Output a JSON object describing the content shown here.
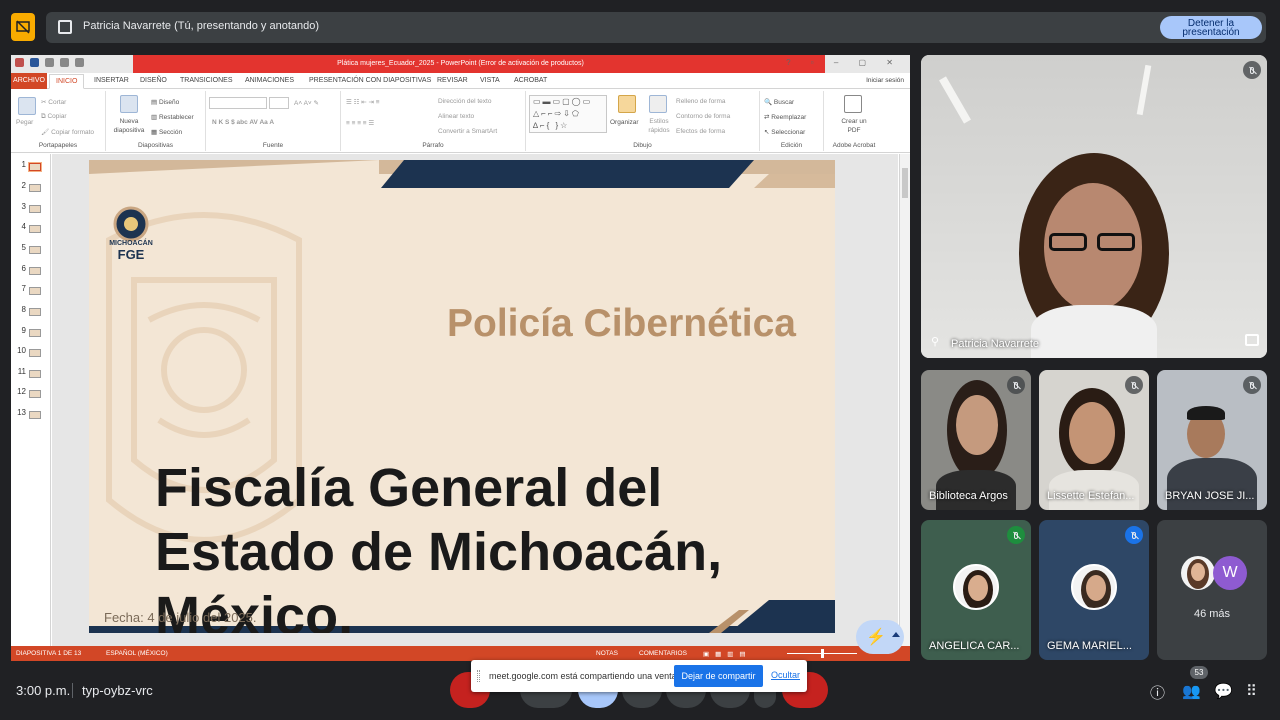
{
  "meet": {
    "presenter_banner": "Patricia Navarrete (Tú, presentando y anotando)",
    "stop_button": "Detener la presentación",
    "time": "3:00 p.m.",
    "meeting_code": "typ-oybz-vrc",
    "people_count": "53",
    "share_notice": {
      "message": "meet.google.com está compartiendo una ventana.",
      "stop_share": "Dejar de compartir",
      "hide": "Ocultar"
    }
  },
  "powerpoint": {
    "window_title": "Plática mujeres_Ecuador_2025 -  PowerPoint (Error de activación de productos)",
    "tabs": [
      "ARCHIVO",
      "INICIO",
      "INSERTAR",
      "DISEÑO",
      "TRANSICIONES",
      "ANIMACIONES",
      "PRESENTACIÓN CON DIAPOSITIVAS",
      "REVISAR",
      "VISTA",
      "ACROBAT"
    ],
    "sign_in": "Iniciar sesión",
    "groups": {
      "clipboard": {
        "label": "Portapapeles",
        "paste": "Pegar",
        "cut": "Cortar",
        "copy": "Copiar",
        "format_painter": "Copiar formato"
      },
      "slides": {
        "label": "Diapositivas",
        "new_slide": "Nueva diapositiva",
        "layout": "Diseño",
        "reset": "Restablecer",
        "section": "Sección"
      },
      "font": {
        "label": "Fuente",
        "buttons": "N  K  S  $  abc  AV  Aa  A"
      },
      "paragraph": {
        "label": "Párrafo",
        "text_direction": "Dirección del texto",
        "align_text": "Alinear texto",
        "smartart": "Convertir a SmartArt"
      },
      "drawing": {
        "label": "Dibujo",
        "arrange": "Organizar",
        "quick_styles": "Estilos rápidos",
        "fill": "Relleno de forma",
        "outline": "Contorno de forma",
        "effects": "Efectos de forma"
      },
      "editing": {
        "label": "Edición",
        "find": "Buscar",
        "replace": "Reemplazar",
        "select": "Seleccionar"
      },
      "acrobat": {
        "label": "Adobe Acrobat",
        "create_pdf": "Crear un PDF"
      }
    },
    "thumbnails": [
      "1",
      "2",
      "3",
      "4",
      "5",
      "6",
      "7",
      "8",
      "9",
      "10",
      "11",
      "12",
      "13"
    ],
    "selected_slide": 1,
    "slide": {
      "subtitle": "Policía Cibernética",
      "title": "Fiscalía General del Estado de Michoacán, México.",
      "date": "Fecha: 4 de julio del 2025.",
      "logo_text": "MICHOACÁN",
      "logo_abbr": "FGE"
    },
    "status": {
      "slide_counter": "DIAPOSITIVA 1 DE 13",
      "language": "ESPAÑOL (MÉXICO)",
      "notes": "NOTAS",
      "comments": "COMENTARIOS"
    }
  },
  "participants": [
    {
      "name": "Patricia Navarrete"
    },
    {
      "name": "Biblioteca Argos"
    },
    {
      "name": "Lissette Estefan..."
    },
    {
      "name": "BRYAN JOSE JI..."
    },
    {
      "name": "ANGELICA CAR..."
    },
    {
      "name": "GEMA MARIEL..."
    },
    {
      "name": "46 más",
      "initial": "W"
    }
  ],
  "colors": {
    "meet_bg": "#202124",
    "ppt_accent": "#d24726",
    "title_error": "#e3342f",
    "slide_bg": "#f3e6d5",
    "slide_navy": "#1c3350",
    "subtitle": "#b8916a"
  }
}
